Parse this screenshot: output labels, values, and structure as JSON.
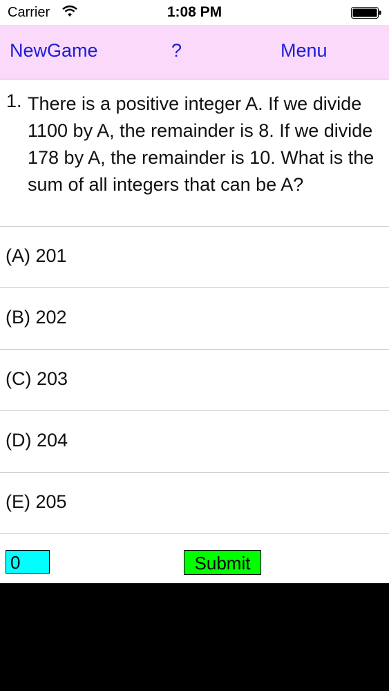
{
  "status_bar": {
    "carrier": "Carrier",
    "time": "1:08 PM",
    "wifi_icon": "wifi-icon",
    "battery_icon": "battery-icon"
  },
  "nav": {
    "new_game": "NewGame",
    "help": "?",
    "menu": "Menu"
  },
  "question": {
    "number": "1.",
    "text": "There is a positive integer A. If we divide 1100 by A, the remainder is 8. If we divide 178 by A, the remainder is 10. What is the sum of all integers that can be A?"
  },
  "answers": [
    {
      "label": "(A) 201"
    },
    {
      "label": "(B) 202"
    },
    {
      "label": "(C) 203"
    },
    {
      "label": "(D) 204"
    },
    {
      "label": "(E) 205"
    }
  ],
  "bottom": {
    "score": "0",
    "submit": "Submit"
  },
  "colors": {
    "nav_background": "#fbd9fb",
    "nav_text": "#1c1cd6",
    "score_field": "#00ffff",
    "submit_button": "#00ff00"
  }
}
